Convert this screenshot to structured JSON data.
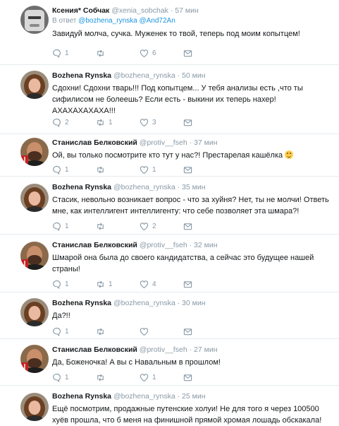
{
  "tweets": [
    {
      "name": "Ксения* Собчак",
      "handle": "@xenia_sobchak",
      "time": "57 мин",
      "reply_prefix": "В ответ",
      "reply_users": "@bozhena_rynska @And72An",
      "text": "Завидуй молча, сучка. Муженек то твой, теперь под моим копытцем!",
      "counts": {
        "reply": "1",
        "retweet": "",
        "like": "6"
      },
      "avatar": "avatar-ksenia"
    },
    {
      "name": "Bozhena Rynska",
      "handle": "@bozhena_rynska",
      "time": "50 мин",
      "text": "Сдохни! Сдохни тварь!!! Под копытцем... У тебя анализы есть ,что ты сифилисом не болеешь? Если есть - выкини их теперь нахер! АХАХАХАХАХА!!!",
      "counts": {
        "reply": "2",
        "retweet": "1",
        "like": "3"
      },
      "avatar": "avatar-bozhena"
    },
    {
      "name": "Станислав Белковский",
      "handle": "@protiv__fseh",
      "time": "37 мин",
      "text": "Ой, вы только посмотрите кто тут у нас?! Престарелая кашёлка",
      "emoji": "smile",
      "counts": {
        "reply": "1",
        "retweet": "",
        "like": "1"
      },
      "avatar": "avatar-stanislav"
    },
    {
      "name": "Bozhena Rynska",
      "handle": "@bozhena_rynska",
      "time": "35 мин",
      "text": "Стасик, невольно возникает вопрос - что за хуйня? Нет, ты не молчи! Ответь мне, как интеллигент интеллигенту: что себе позволяет эта шмара?!",
      "counts": {
        "reply": "1",
        "retweet": "",
        "like": "2"
      },
      "avatar": "avatar-bozhena"
    },
    {
      "name": "Станислав Белковский",
      "handle": "@protiv__fseh",
      "time": "32 мин",
      "text": "Шмарой она была до своего кандидатства, а сейчас это будущее нашей страны!",
      "counts": {
        "reply": "1",
        "retweet": "1",
        "like": "4"
      },
      "avatar": "avatar-stanislav"
    },
    {
      "name": "Bozhena Rynska",
      "handle": "@bozhena_rynska",
      "time": "30 мин",
      "text": "Да?!!",
      "counts": {
        "reply": "1",
        "retweet": "",
        "like": ""
      },
      "avatar": "avatar-bozhena"
    },
    {
      "name": "Станислав Белковский",
      "handle": "@protiv__fseh",
      "time": "27 мин",
      "text": "Да, Боженочка! А вы с Навальным в прошлом!",
      "counts": {
        "reply": "1",
        "retweet": "",
        "like": "1"
      },
      "avatar": "avatar-stanislav"
    },
    {
      "name": "Bozhena Rynska",
      "handle": "@bozhena_rynska",
      "time": "25 мин",
      "text": "Ещё посмотрим, продажные путенские холуи! Не для того я через 100500 хуёв прошла, что б меня на финишной прямой хромая лошадь обскакала!",
      "counts": {
        "reply": "",
        "retweet": "",
        "like": ""
      },
      "avatar": "avatar-bozhena"
    }
  ],
  "dot": "·",
  "icons": [
    "reply-icon",
    "retweet-icon",
    "like-icon",
    "dm-icon"
  ],
  "colors": {
    "text": "#14171a",
    "muted": "#8899a6",
    "link": "#1b95e0",
    "divider": "#e6ecf0"
  }
}
